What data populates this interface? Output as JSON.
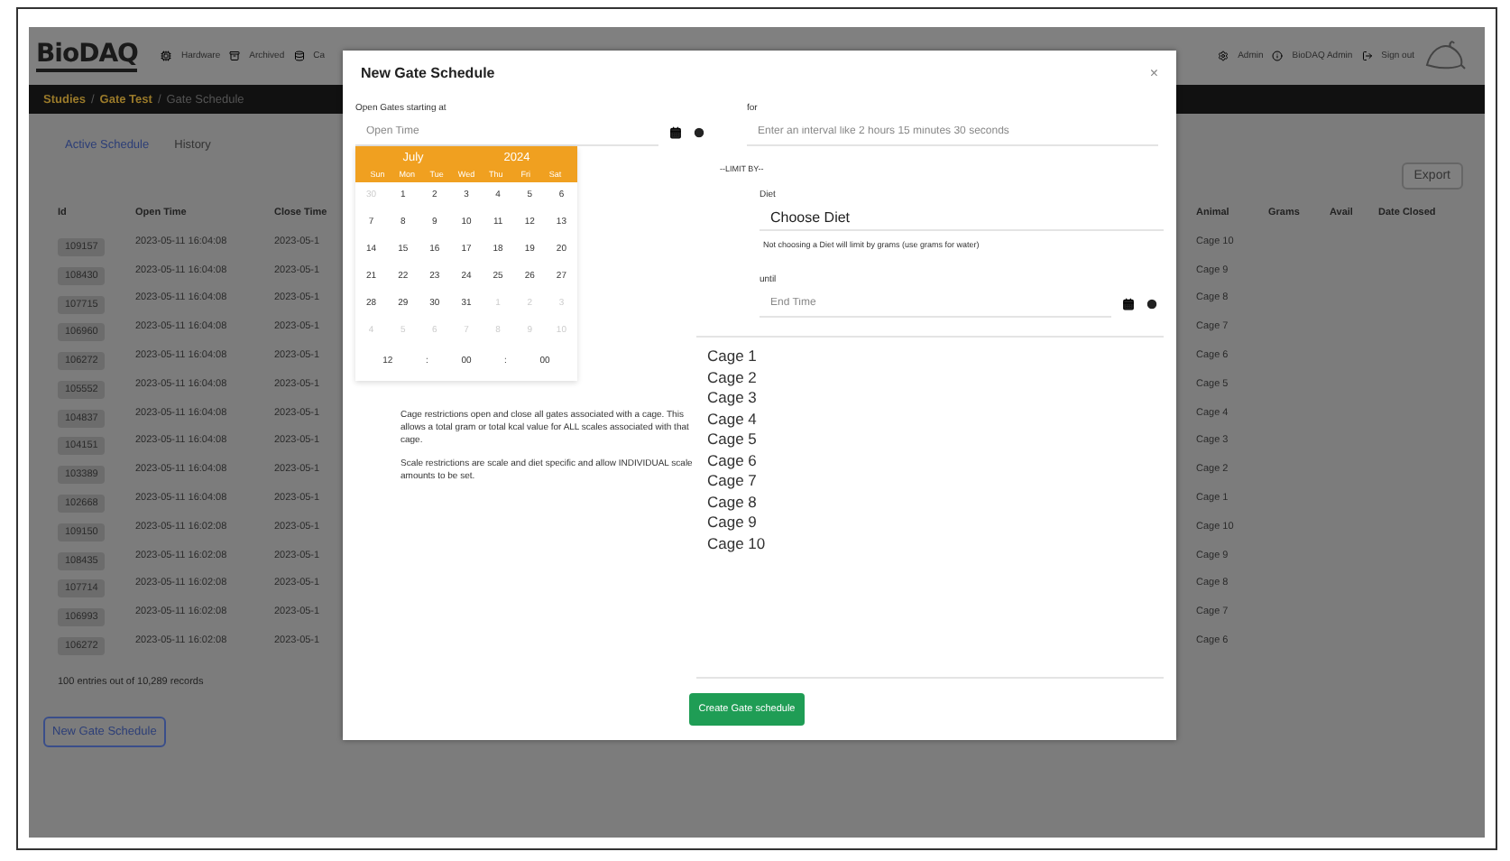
{
  "navbar": {
    "logo": "BioDAQ",
    "left_items": [
      "Hardware",
      "Archived",
      "Ca"
    ],
    "right_items": [
      "Admin",
      "BioDAQ Admin",
      "Sign out"
    ]
  },
  "breadcrumb": [
    {
      "text": "Studies",
      "kind": "link"
    },
    {
      "text": "/",
      "kind": "separator"
    },
    {
      "text": "Gate Test",
      "kind": "link"
    },
    {
      "text": "/",
      "kind": "separator"
    },
    {
      "text": "Gate Schedule",
      "kind": "current"
    }
  ],
  "tabs": [
    {
      "label": "Active Schedule",
      "selected": true
    },
    {
      "label": "History",
      "selected": false
    }
  ],
  "export_button": "Export",
  "table": {
    "columns": [
      "Id",
      "Open Time",
      "Close Time",
      "Animal",
      "Grams",
      "Avail",
      "Date Closed"
    ],
    "rows": [
      {
        "id": "109157",
        "open": "2023-05-11 16:04:08",
        "close": "2023-05-1",
        "animal": "Cage 10"
      },
      {
        "id": "108430",
        "open": "2023-05-11 16:04:08",
        "close": "2023-05-1",
        "animal": "Cage 9"
      },
      {
        "id": "107715",
        "open": "2023-05-11 16:04:08",
        "close": "2023-05-1",
        "animal": "Cage 8"
      },
      {
        "id": "106960",
        "open": "2023-05-11 16:04:08",
        "close": "2023-05-1",
        "animal": "Cage 7"
      },
      {
        "id": "106272",
        "open": "2023-05-11 16:04:08",
        "close": "2023-05-1",
        "animal": "Cage 6"
      },
      {
        "id": "105552",
        "open": "2023-05-11 16:04:08",
        "close": "2023-05-1",
        "animal": "Cage 5"
      },
      {
        "id": "104837",
        "open": "2023-05-11 16:04:08",
        "close": "2023-05-1",
        "animal": "Cage 4"
      },
      {
        "id": "104151",
        "open": "2023-05-11 16:04:08",
        "close": "2023-05-1",
        "animal": "Cage 3"
      },
      {
        "id": "103389",
        "open": "2023-05-11 16:04:08",
        "close": "2023-05-1",
        "animal": "Cage 2"
      },
      {
        "id": "102668",
        "open": "2023-05-11 16:04:08",
        "close": "2023-05-1",
        "animal": "Cage 1"
      },
      {
        "id": "109150",
        "open": "2023-05-11 16:02:08",
        "close": "2023-05-1",
        "animal": "Cage 10"
      },
      {
        "id": "108435",
        "open": "2023-05-11 16:02:08",
        "close": "2023-05-1",
        "animal": "Cage 9"
      },
      {
        "id": "107714",
        "open": "2023-05-11 16:02:08",
        "close": "2023-05-1",
        "animal": "Cage 8"
      },
      {
        "id": "106993",
        "open": "2023-05-11 16:02:08",
        "close": "2023-05-1",
        "animal": "Cage 7"
      },
      {
        "id": "106272",
        "open": "2023-05-11 16:02:08",
        "close": "2023-05-1",
        "animal": "Cage 6"
      }
    ]
  },
  "entries_note": "100 entries out of 10,289 records",
  "new_button": "New Gate Schedule",
  "modal": {
    "title": "New Gate Schedule",
    "close": "×",
    "open_label": "Open Gates starting at",
    "open_placeholder": "Open Time",
    "calendar": {
      "month": "July",
      "year": "2024",
      "weekdays": [
        "Sun",
        "Mon",
        "Tue",
        "Wed",
        "Thu",
        "Fri",
        "Sat"
      ],
      "weeks": [
        [
          {
            "d": "30",
            "muted": true
          },
          {
            "d": "1",
            "muted": false
          },
          {
            "d": "2",
            "muted": false
          },
          {
            "d": "3",
            "muted": false
          },
          {
            "d": "4",
            "muted": false
          },
          {
            "d": "5",
            "muted": false
          },
          {
            "d": "6",
            "muted": false
          }
        ],
        [
          {
            "d": "7",
            "muted": false
          },
          {
            "d": "8",
            "muted": false
          },
          {
            "d": "9",
            "muted": false
          },
          {
            "d": "10",
            "muted": false
          },
          {
            "d": "11",
            "muted": false
          },
          {
            "d": "12",
            "muted": false
          },
          {
            "d": "13",
            "muted": false
          }
        ],
        [
          {
            "d": "14",
            "muted": false
          },
          {
            "d": "15",
            "muted": false
          },
          {
            "d": "16",
            "muted": false
          },
          {
            "d": "17",
            "muted": false
          },
          {
            "d": "18",
            "muted": false
          },
          {
            "d": "19",
            "muted": false
          },
          {
            "d": "20",
            "muted": false
          }
        ],
        [
          {
            "d": "21",
            "muted": false
          },
          {
            "d": "22",
            "muted": false
          },
          {
            "d": "23",
            "muted": false
          },
          {
            "d": "24",
            "muted": false
          },
          {
            "d": "25",
            "muted": false
          },
          {
            "d": "26",
            "muted": false
          },
          {
            "d": "27",
            "muted": false
          }
        ],
        [
          {
            "d": "28",
            "muted": false
          },
          {
            "d": "29",
            "muted": false
          },
          {
            "d": "30",
            "muted": false
          },
          {
            "d": "31",
            "muted": false
          },
          {
            "d": "1",
            "muted": true
          },
          {
            "d": "2",
            "muted": true
          },
          {
            "d": "3",
            "muted": true
          }
        ],
        [
          {
            "d": "4",
            "muted": true
          },
          {
            "d": "5",
            "muted": true
          },
          {
            "d": "6",
            "muted": true
          },
          {
            "d": "7",
            "muted": true
          },
          {
            "d": "8",
            "muted": true
          },
          {
            "d": "9",
            "muted": true
          },
          {
            "d": "10",
            "muted": true
          }
        ]
      ],
      "time": [
        "12",
        ":",
        "00",
        ":",
        "00"
      ]
    },
    "notes": [
      "Cage restrictions open and close all gates associated with a cage. This allows a total gram or total kcal value for ALL scales associated with that cage.",
      "Scale restrictions are scale and diet specific and allow INDIVIDUAL scale amounts to be set."
    ],
    "for_label": "for",
    "for_placeholder": "Enter an interval like 2 hours 15 minutes 30 seconds",
    "limit_by": "--LIMIT BY--",
    "diet_label": "Diet",
    "diet_value": "Choose Diet",
    "diet_hint": "Not choosing a Diet will limit by grams (use grams for water)",
    "until_label": "until",
    "until_placeholder": "End Time",
    "cages": [
      {
        "label": "Cage 1",
        "selected": false
      },
      {
        "label": "Cage 2",
        "selected": false
      },
      {
        "label": "Cage 3",
        "selected": false
      },
      {
        "label": "Cage 4",
        "selected": false
      },
      {
        "label": "Cage 5",
        "selected": false
      },
      {
        "label": "Cage 6",
        "selected": false
      },
      {
        "label": "Cage 7",
        "selected": false
      },
      {
        "label": "Cage 8",
        "selected": false
      },
      {
        "label": "Cage 9",
        "selected": false
      },
      {
        "label": "Cage 10",
        "selected": false
      }
    ],
    "submit": "Create Gate schedule"
  }
}
